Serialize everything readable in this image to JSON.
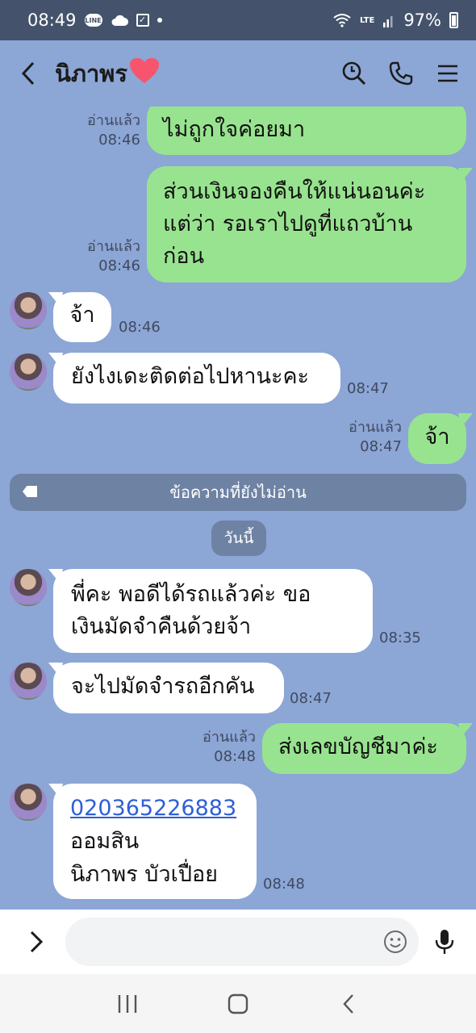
{
  "status_bar": {
    "time": "08:49",
    "line_badge": "LINE",
    "battery": "97%",
    "network": "LTE"
  },
  "header": {
    "title": "นิภาพร",
    "title_emoji": "❤️"
  },
  "messages": [
    {
      "side": "me",
      "text": "ไม่ถูกใจค่อยมา",
      "read": "อ่านแล้ว",
      "time": "08:46"
    },
    {
      "side": "me",
      "lines": [
        "ส่วนเงินจองคืนให้แน่นอนค่ะ",
        "แต่ว่า รอเราไปดูที่แถวบ้าน",
        "ก่อน"
      ],
      "read": "อ่านแล้ว",
      "time": "08:46"
    },
    {
      "side": "them",
      "text": "จ้า",
      "time": "08:46"
    },
    {
      "side": "them",
      "text": "ยังไงเดะติดต่อไปหานะคะ",
      "time": "08:47"
    },
    {
      "side": "me",
      "text": "จ้า",
      "read": "อ่านแล้ว",
      "time": "08:47"
    },
    {
      "side": "them",
      "lines": [
        "พี่คะ พอดีได้รถแล้วค่ะ ขอ",
        "เงินมัดจำคืนด้วยจ้า"
      ],
      "time": "08:35"
    },
    {
      "side": "them",
      "text": "จะไปมัดจำรถอีกคัน",
      "time": "08:47"
    },
    {
      "side": "me",
      "text": "ส่งเลขบัญชีมาค่ะ",
      "read": "อ่านแล้ว",
      "time": "08:48"
    },
    {
      "side": "them",
      "lines": [
        "020365226883",
        "ออมสิน",
        "นิภาพร  บัวเปื่อย"
      ],
      "time": "08:48"
    }
  ],
  "unread_divider": "ข้อความที่ยังไม่อ่าน",
  "date_chip": "วันนี้",
  "input": {
    "placeholder": ""
  },
  "colors": {
    "background": "#8ca6d6",
    "my_bubble": "#98e38f",
    "their_bubble": "#ffffff",
    "status_bar": "#44536b",
    "link": "#2f5fd8"
  }
}
